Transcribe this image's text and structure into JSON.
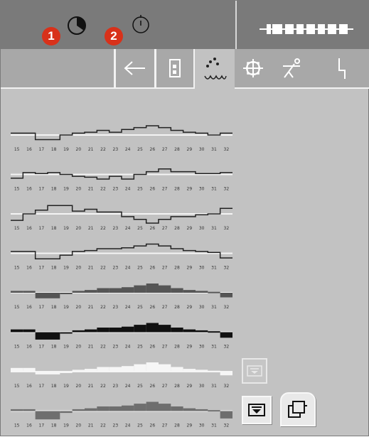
{
  "status_badges": {
    "first": "1",
    "second": "2"
  },
  "top_icons": [
    "clock-icon",
    "timer-icon"
  ],
  "brand": {
    "logo_icon": "heidelberg-logo"
  },
  "tabs": [
    {
      "name": "back",
      "icon": "arrow-left-icon"
    },
    {
      "name": "ink",
      "icon": "ink-unit-icon"
    },
    {
      "name": "dampening",
      "icon": "dots-wave-icon",
      "selected": true
    },
    {
      "name": "register",
      "icon": "register-cross-icon"
    },
    {
      "name": "operator",
      "icon": "person-icon"
    },
    {
      "name": "diagnostics",
      "icon": "lightning-icon"
    }
  ],
  "ink_zones": {
    "zone_numbers": [
      "15",
      "16",
      "17",
      "18",
      "19",
      "20",
      "21",
      "22",
      "23",
      "24",
      "25",
      "26",
      "27",
      "28",
      "29",
      "30",
      "31",
      "32"
    ],
    "profiles": [
      {
        "style": "outline",
        "values": [
          0.2,
          0.2,
          -0.5,
          -0.5,
          0,
          0.2,
          0.3,
          0.5,
          0.3,
          0.6,
          0.8,
          1,
          0.8,
          0.5,
          0.3,
          0.2,
          0,
          0.2
        ]
      },
      {
        "style": "outline",
        "values": [
          -0.4,
          0.2,
          0.1,
          0.2,
          0,
          -0.2,
          -0.3,
          -0.5,
          -0.2,
          -0.5,
          0,
          0.3,
          0.6,
          0.3,
          0.3,
          0.1,
          0.1,
          0.2
        ]
      },
      {
        "style": "outline",
        "values": [
          -0.7,
          0,
          0.4,
          0.9,
          0.9,
          0.3,
          0.5,
          0.2,
          0.2,
          -0.3,
          -0.6,
          -1,
          -0.6,
          -0.3,
          -0.3,
          -0.1,
          0,
          0.6
        ]
      },
      {
        "style": "outline",
        "values": [
          0.2,
          0.2,
          -0.6,
          -0.6,
          -0.2,
          0.2,
          0.3,
          0.5,
          0.5,
          0.6,
          0.8,
          1,
          0.8,
          0.5,
          0.3,
          0.2,
          0.1,
          -0.5
        ]
      },
      {
        "style": "dark-gray",
        "values": [
          0.2,
          0.2,
          -0.6,
          -0.6,
          -0.1,
          0.2,
          0.3,
          0.5,
          0.5,
          0.6,
          0.8,
          1,
          0.8,
          0.5,
          0.3,
          0.2,
          0.1,
          -0.5
        ]
      },
      {
        "style": "black",
        "values": [
          0.3,
          0.3,
          -0.8,
          -0.8,
          -0.1,
          0.2,
          0.3,
          0.5,
          0.5,
          0.6,
          0.8,
          1,
          0.8,
          0.5,
          0.3,
          0.2,
          0.1,
          -0.6
        ]
      },
      {
        "style": "white",
        "values": [
          0.4,
          0.4,
          -0.3,
          -0.3,
          -0.1,
          0.2,
          0.3,
          0.5,
          0.5,
          0.6,
          0.8,
          1,
          0.8,
          0.5,
          0.3,
          0.2,
          0.1,
          -0.4
        ]
      },
      {
        "style": "mid-gray",
        "values": [
          0.2,
          0.2,
          -0.9,
          -0.9,
          -0.2,
          0.2,
          0.3,
          0.5,
          0.5,
          0.6,
          0.8,
          1,
          0.8,
          0.5,
          0.3,
          0.2,
          0.1,
          -0.8
        ]
      }
    ]
  },
  "side_buttons": [
    {
      "name": "expand-disabled",
      "icon": "expand-icon",
      "enabled": false
    },
    {
      "name": "expand",
      "icon": "expand-icon",
      "enabled": true
    },
    {
      "name": "copy",
      "icon": "copy-icon",
      "enabled": true
    }
  ],
  "colors": {
    "panel": "#c2c2c2",
    "topbar": "#7a7a7a",
    "tabbar": "#a8a8a8",
    "badge": "#d8311a",
    "outline": "#222222",
    "dark-gray": "#555555",
    "black": "#111111",
    "white": "#f6f6f6",
    "mid-gray": "#6e6e6e"
  }
}
